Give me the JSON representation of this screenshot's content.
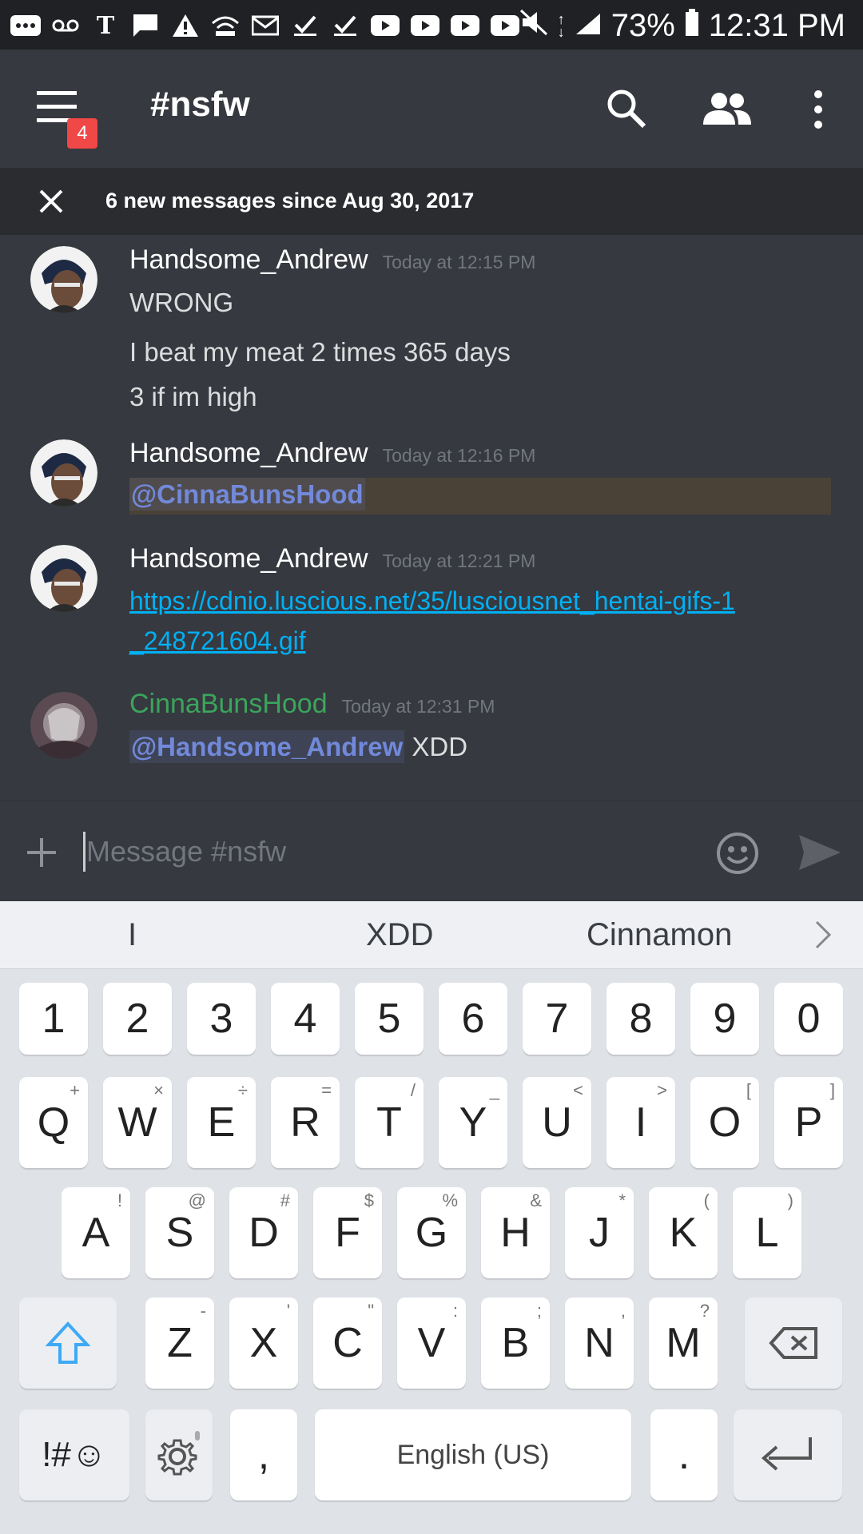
{
  "status": {
    "battery": "73%",
    "time": "12:31 PM"
  },
  "header": {
    "channel": "#nsfw",
    "badge_count": "4"
  },
  "new_messages_bar": {
    "text": "6 new messages since Aug 30, 2017"
  },
  "messages": [
    {
      "user": "Handsome_Andrew",
      "time": "Today at 12:15 PM",
      "lines": [
        "WRONG",
        "I beat my meat 2 times 365 days",
        "3 if im high"
      ]
    },
    {
      "user": "Handsome_Andrew",
      "time": "Today at 12:16 PM",
      "mention": "@CinnaBunsHood"
    },
    {
      "user": "Handsome_Andrew",
      "time": "Today at 12:21 PM",
      "link_line1": "https://cdnio.luscious.net/35/lusciousnet_hentai-gifs-1",
      "link_line2": "_248721604.gif"
    },
    {
      "user": "CinnaBunsHood",
      "user_color": "#3ba55c",
      "time": "Today at 12:31 PM",
      "mention": "@Handsome_Andrew",
      "text": " XDD"
    }
  ],
  "input": {
    "placeholder": "Message #nsfw"
  },
  "keyboard": {
    "suggestions": [
      "I",
      "XDD",
      "Cinnamon"
    ],
    "row_numbers": [
      "1",
      "2",
      "3",
      "4",
      "5",
      "6",
      "7",
      "8",
      "9",
      "0"
    ],
    "row_q": [
      [
        "Q",
        "+"
      ],
      [
        "W",
        "×"
      ],
      [
        "E",
        "÷"
      ],
      [
        "R",
        "="
      ],
      [
        "T",
        "/"
      ],
      [
        "Y",
        "_"
      ],
      [
        "U",
        "<"
      ],
      [
        "I",
        ">"
      ],
      [
        "O",
        "["
      ],
      [
        "P",
        "]"
      ]
    ],
    "row_a": [
      [
        "A",
        "!"
      ],
      [
        "S",
        "@"
      ],
      [
        "D",
        "#"
      ],
      [
        "F",
        "$"
      ],
      [
        "G",
        "%"
      ],
      [
        "H",
        "&"
      ],
      [
        "J",
        "*"
      ],
      [
        "K",
        "("
      ],
      [
        "L",
        ")"
      ]
    ],
    "row_z": [
      [
        "Z",
        "-"
      ],
      [
        "X",
        "'"
      ],
      [
        "C",
        "\""
      ],
      [
        "V",
        ":"
      ],
      [
        "B",
        ";"
      ],
      [
        "N",
        ","
      ],
      [
        "M",
        "?"
      ]
    ],
    "symbols_label": "!#☺",
    "comma": ",",
    "space_label": "English (US)",
    "period": "."
  },
  "colors": {
    "background": "#36393f",
    "mention": "#7289da",
    "link": "#00b0f4",
    "badge": "#f04747"
  }
}
